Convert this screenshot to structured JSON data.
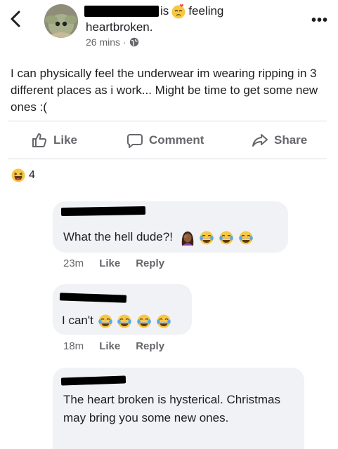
{
  "header": {
    "author_suffix": "is",
    "feeling_label": "feeling",
    "feeling_value": "heartbroken.",
    "time": "26 mins ·",
    "more_label": "•••"
  },
  "post": {
    "text": "I can physically feel the underwear im wearing ripping in 3 different places as i work... Might be time to get some new ones :("
  },
  "actions": {
    "like": "Like",
    "comment": "Comment",
    "share": "Share"
  },
  "reactions": {
    "count": "4"
  },
  "comments": [
    {
      "text": "What the hell dude?!",
      "time": "23m",
      "like": "Like",
      "reply": "Reply"
    },
    {
      "text": "I can't",
      "time": "18m",
      "like": "Like",
      "reply": "Reply"
    },
    {
      "text": "The heart broken is hysterical. Christmas may bring you some new ones."
    }
  ],
  "colors": {
    "bubble": "#f0f2f5",
    "secondary_text": "#65676b",
    "redaction": "#000000"
  }
}
